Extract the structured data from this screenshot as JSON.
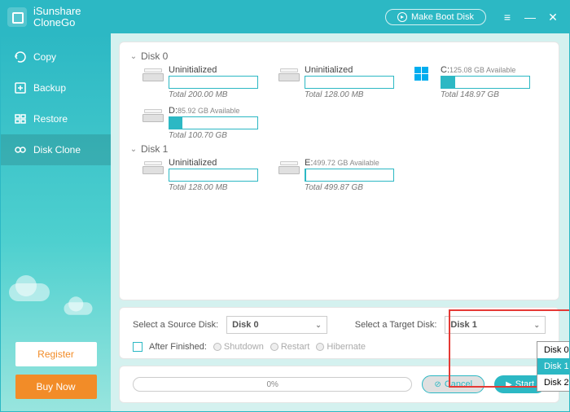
{
  "app": {
    "name": "iSunshare\nCloneGo"
  },
  "titlebar": {
    "make_boot": "Make Boot Disk"
  },
  "nav": {
    "copy": "Copy",
    "backup": "Backup",
    "restore": "Restore",
    "disk_clone": "Disk Clone"
  },
  "side_buttons": {
    "register": "Register",
    "buy": "Buy Now"
  },
  "disks": {
    "disk0": {
      "label": "Disk 0",
      "parts": [
        {
          "title": "Uninitialized",
          "sub": "",
          "total": "Total 200.00 MB",
          "fill": 0,
          "icon": "hdd"
        },
        {
          "title": "Uninitialized",
          "sub": "",
          "total": "Total 128.00 MB",
          "fill": 0,
          "icon": "hdd"
        },
        {
          "title": "C:",
          "sub": "125.08 GB Available",
          "total": "Total 148.97 GB",
          "fill": 16,
          "icon": "win"
        },
        {
          "title": "D:",
          "sub": "85.92 GB Available",
          "total": "Total 100.70 GB",
          "fill": 15,
          "icon": "hdd"
        }
      ]
    },
    "disk1": {
      "label": "Disk 1",
      "parts": [
        {
          "title": "Uninitialized",
          "sub": "",
          "total": "Total 128.00 MB",
          "fill": 0,
          "icon": "hdd"
        },
        {
          "title": "E:",
          "sub": "499.72 GB Available",
          "total": "Total 499.87 GB",
          "fill": 0.5,
          "icon": "hdd"
        }
      ]
    }
  },
  "select": {
    "source_label": "Select a Source Disk:",
    "source_value": "Disk 0",
    "target_label": "Select a Target Disk:",
    "target_value": "Disk 1",
    "after_label": "After Finished:",
    "shutdown": "Shutdown",
    "restart": "Restart",
    "hibernate": "Hibernate",
    "dropdown": [
      "Disk 0",
      "Disk 1",
      "Disk 2"
    ],
    "dropdown_selected": 1
  },
  "progress": {
    "percent": "0%",
    "cancel": "Cancel",
    "start": "Start"
  }
}
